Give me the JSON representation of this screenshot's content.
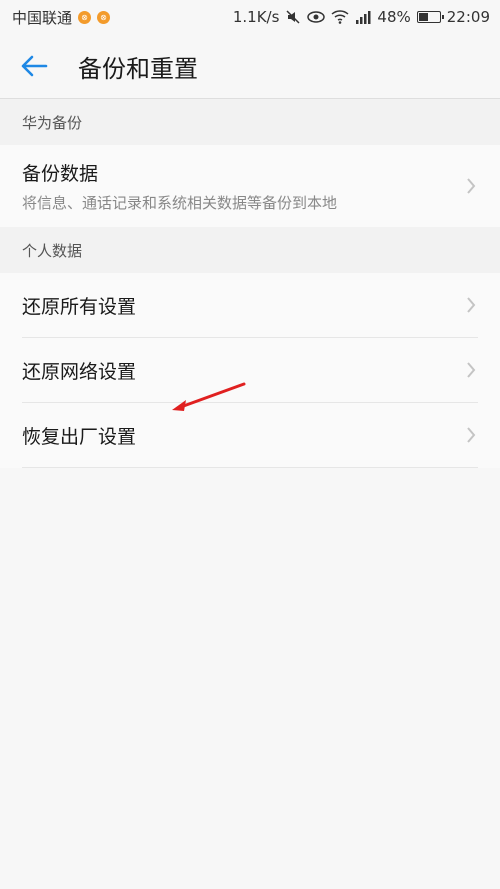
{
  "status_bar": {
    "carrier": "中国联通",
    "carrier_badge_1": "⊗",
    "carrier_badge_2": "⊗",
    "net_speed": "1.1K/s",
    "battery_percent": "48%",
    "battery_level": 0.48,
    "time": "22:09"
  },
  "app_bar": {
    "title": "备份和重置"
  },
  "sections": [
    {
      "header": "华为备份",
      "items": [
        {
          "title": "备份数据",
          "subtitle": "将信息、通话记录和系统相关数据等备份到本地"
        }
      ]
    },
    {
      "header": "个人数据",
      "items": [
        {
          "title": "还原所有设置"
        },
        {
          "title": "还原网络设置"
        },
        {
          "title": "恢复出厂设置"
        }
      ]
    }
  ],
  "colors": {
    "accent": "#1e88e5",
    "annotation": "#e02020"
  },
  "icons": {
    "back": "arrow-left-icon",
    "chevron": "chevron-right-icon"
  }
}
